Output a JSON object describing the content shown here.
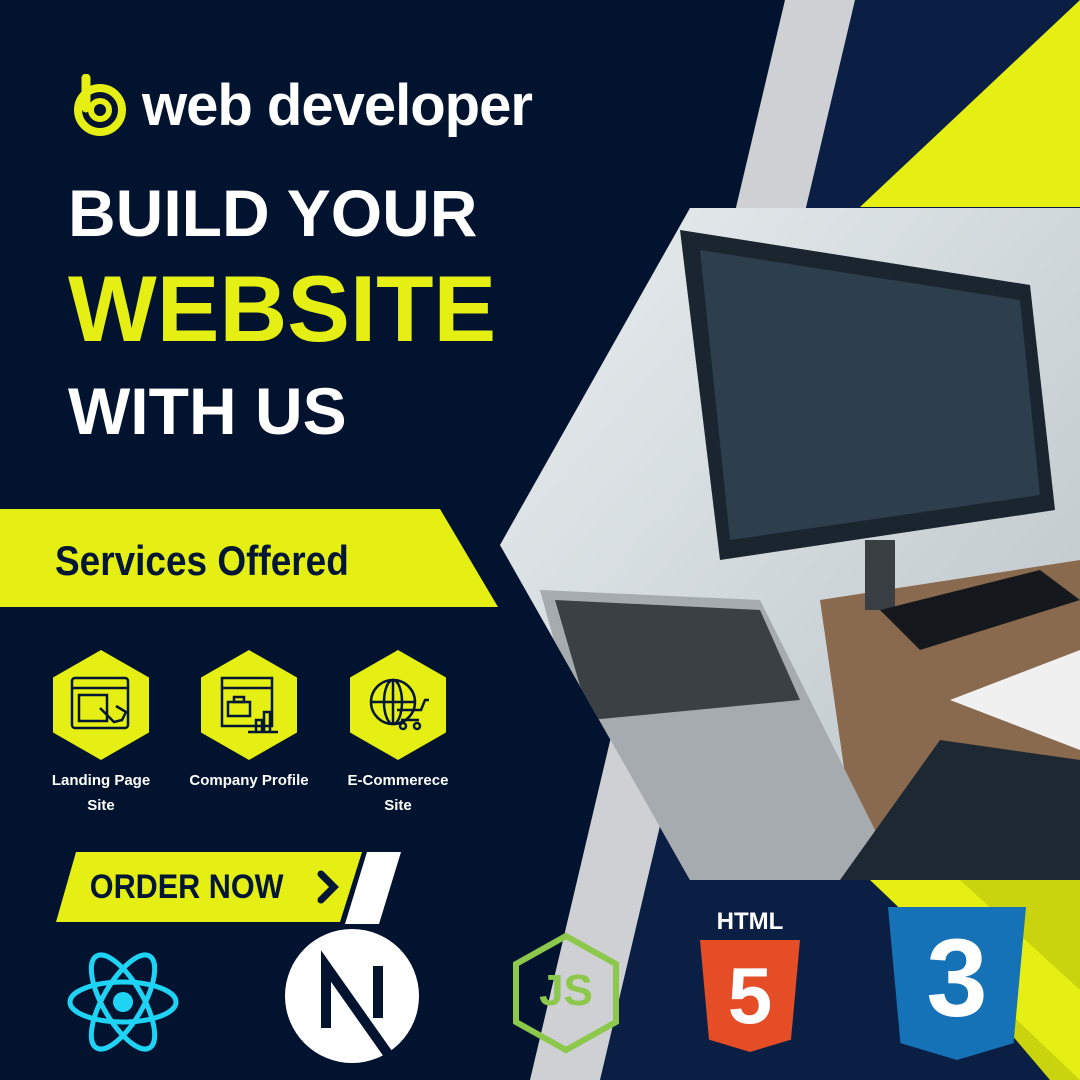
{
  "brand": {
    "name": "web developer"
  },
  "headline": {
    "line1": "BUILD YOUR",
    "line2": "WEBSITE",
    "line3": "WITH US"
  },
  "services": {
    "title": "Services Offered",
    "items": [
      {
        "label_line1": "Landing Page",
        "label_line2": "Site",
        "icon": "landing-page-icon"
      },
      {
        "label_line1": "Company Profile",
        "label_line2": "",
        "icon": "company-profile-icon"
      },
      {
        "label_line1": "E-Commerece",
        "label_line2": "Site",
        "icon": "ecommerce-icon"
      }
    ]
  },
  "cta": {
    "label": "ORDER NOW"
  },
  "tech": {
    "html_label": "HTML",
    "html_num": "5",
    "css_num": "3",
    "node_label": "JS"
  },
  "colors": {
    "accent": "#e5ef13",
    "navy": "#021330"
  }
}
